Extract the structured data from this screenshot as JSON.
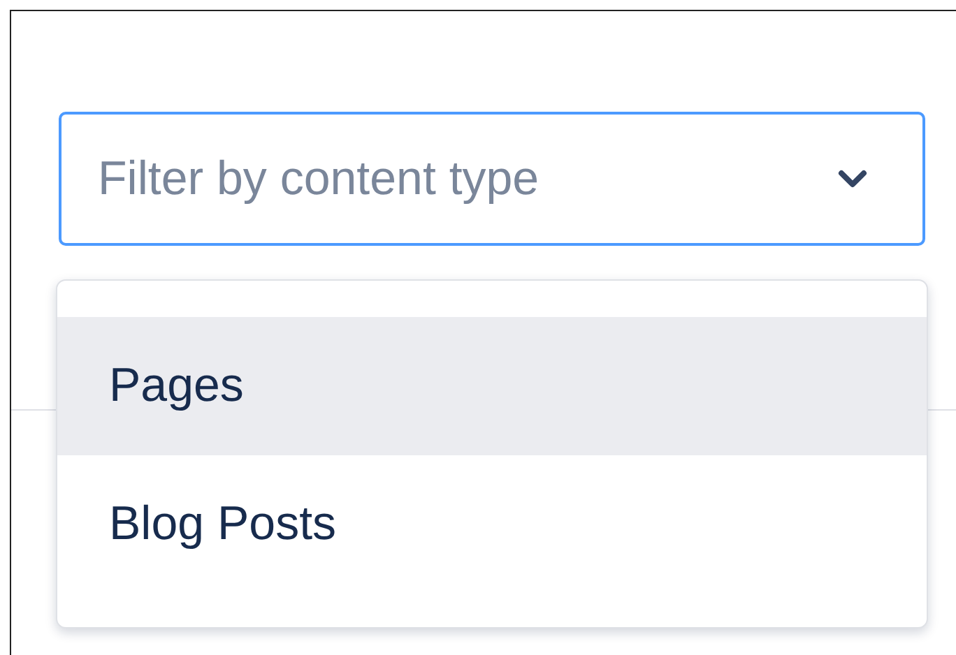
{
  "filter": {
    "placeholder": "Filter by content type",
    "focused": true
  },
  "menu": {
    "items": [
      {
        "label": "Pages",
        "selected": true
      },
      {
        "label": "Blog Posts",
        "selected": false
      }
    ]
  }
}
